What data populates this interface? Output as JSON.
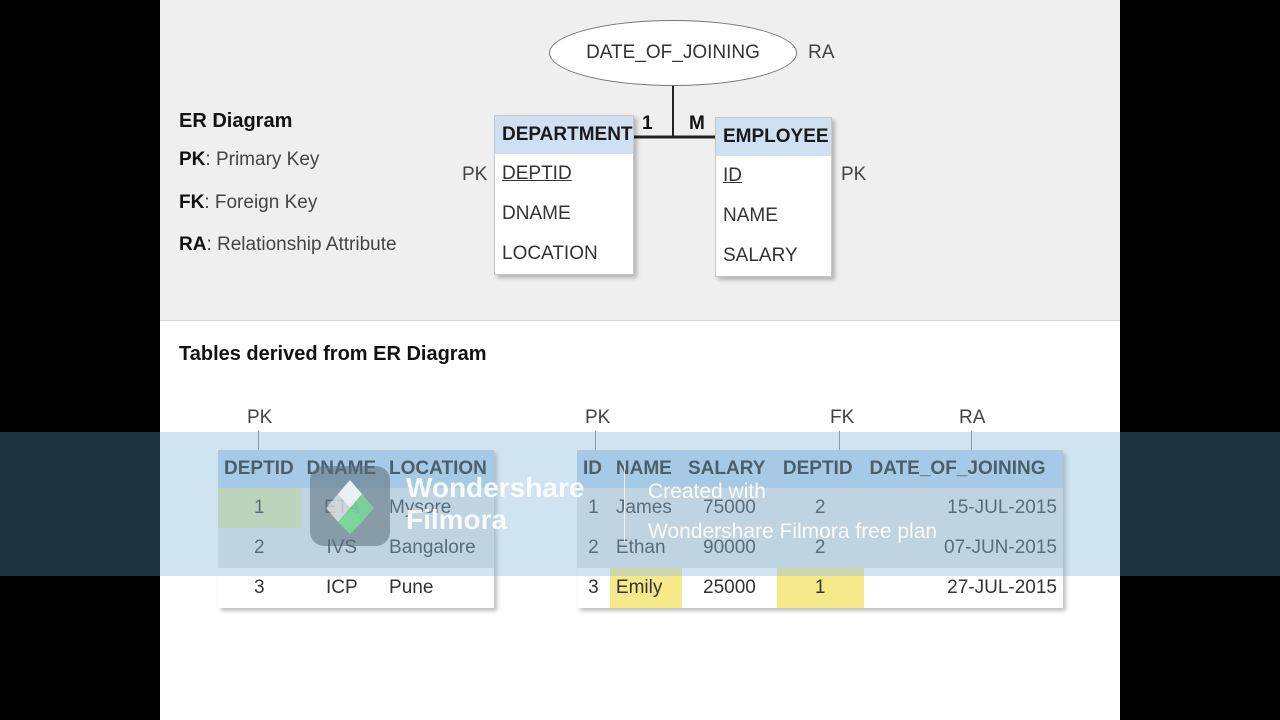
{
  "legend": {
    "title": "ER Diagram",
    "items": [
      {
        "key": "PK",
        "desc": ": Primary Key"
      },
      {
        "key": "FK",
        "desc": ": Foreign Key"
      },
      {
        "key": "RA",
        "desc": ": Relationship Attribute"
      }
    ]
  },
  "er": {
    "relationship_attribute": "DATE_OF_JOINING",
    "ra_label": "RA",
    "cardinality_left": "1",
    "cardinality_right": "M",
    "department": {
      "title": "DEPARTMENT",
      "pk_label": "PK",
      "attributes": [
        "DEPTID",
        "DNAME",
        "LOCATION"
      ]
    },
    "employee": {
      "title": "EMPLOYEE",
      "pk_label": "PK",
      "attributes": [
        "ID",
        "NAME",
        "SALARY"
      ]
    }
  },
  "tables_section": {
    "title": "Tables derived from ER Diagram",
    "department_table": {
      "key_labels": [
        "PK"
      ],
      "headers": [
        "DEPTID",
        "DNAME",
        "LOCATION"
      ],
      "rows": [
        [
          "1",
          "ETA",
          "Mysore"
        ],
        [
          "2",
          "IVS",
          "Bangalore"
        ],
        [
          "3",
          "ICP",
          "Pune"
        ]
      ]
    },
    "employee_table": {
      "key_labels": [
        "PK",
        "FK",
        "RA"
      ],
      "headers": [
        "ID",
        "NAME",
        "SALARY",
        "DEPTID",
        "DATE_OF_JOINING"
      ],
      "rows": [
        [
          "1",
          "James",
          "75000",
          "2",
          "15-JUL-2015"
        ],
        [
          "2",
          "Ethan",
          "90000",
          "2",
          "07-JUN-2015"
        ],
        [
          "3",
          "Emily",
          "25000",
          "1",
          "27-JUL-2015"
        ]
      ]
    }
  },
  "watermark": {
    "brand_line1": "Wondershare",
    "brand_line2": "Filmora",
    "note_line1": "Created with",
    "note_line2": "Wondershare Filmora free plan"
  },
  "colors": {
    "entity_header": "#cfe0f3",
    "table_header": "#b9d2ee",
    "highlight": "#f6e98a"
  }
}
